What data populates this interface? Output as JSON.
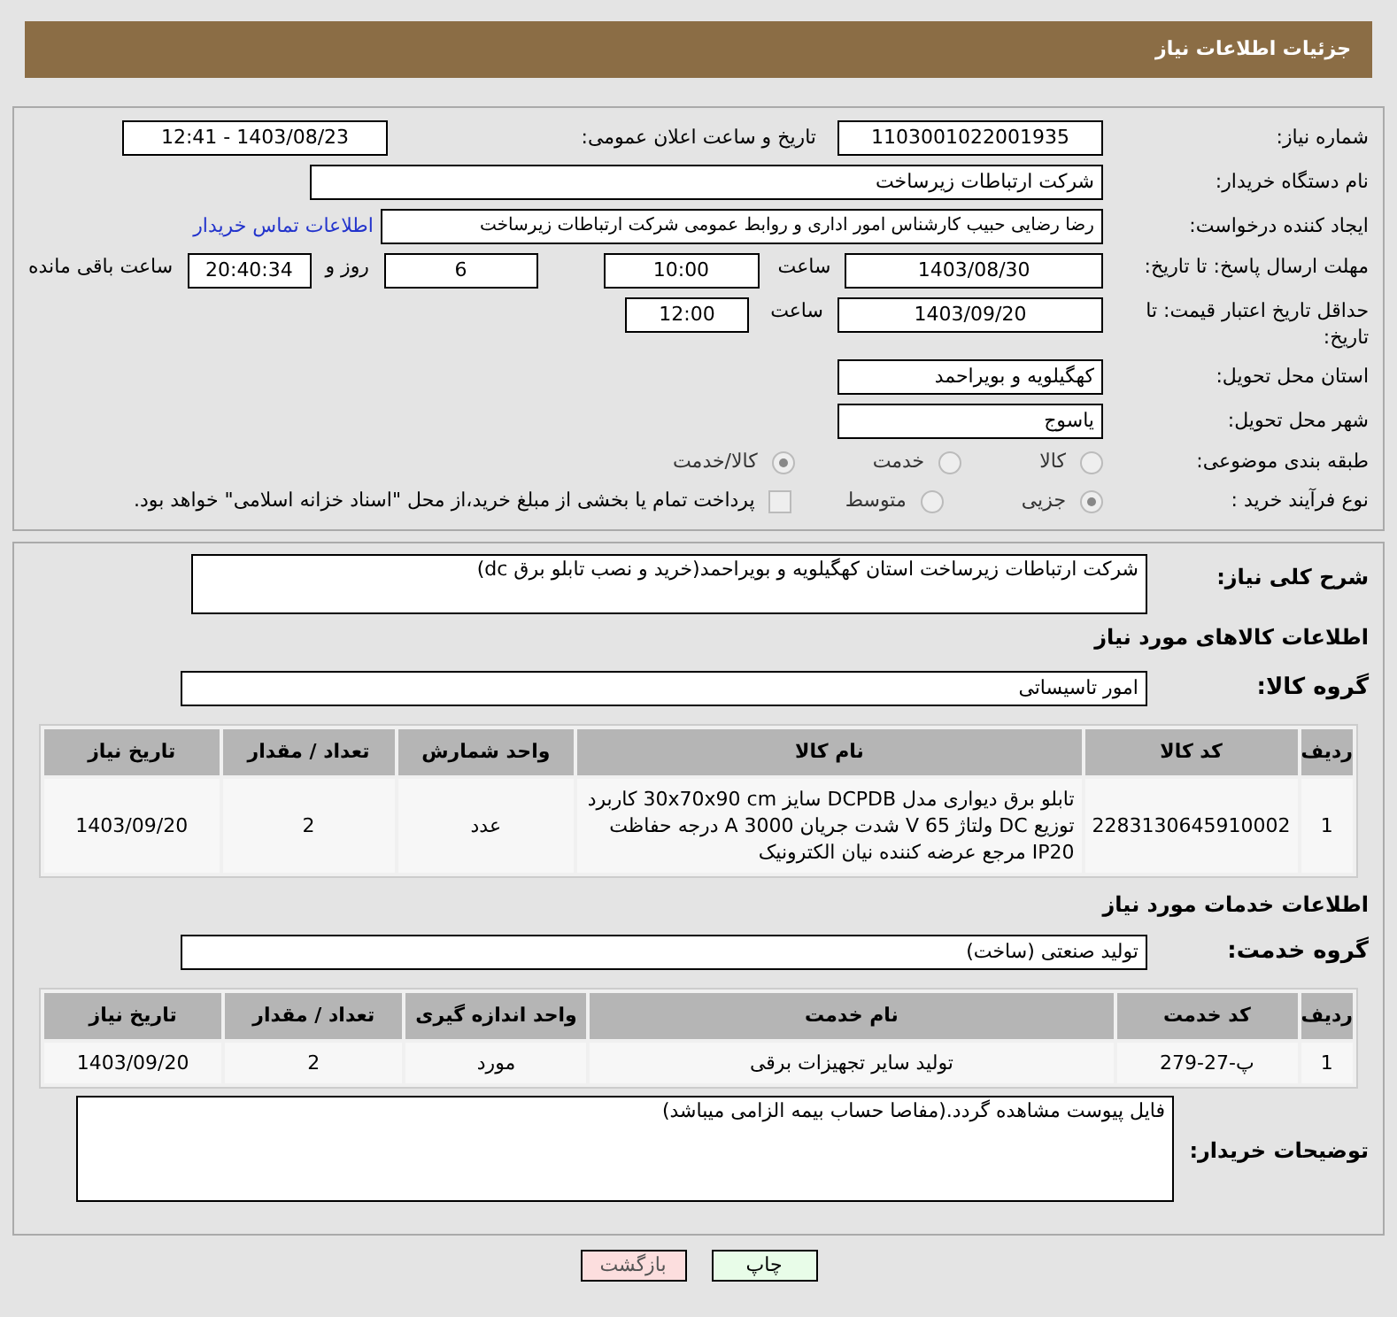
{
  "header": {
    "title": "جزئیات اطلاعات نیاز"
  },
  "need_number": {
    "label": "شماره نیاز:",
    "value": "1103001022001935"
  },
  "announce": {
    "label": "تاریخ و ساعت اعلان عمومی:",
    "value": "1403/08/23 - 12:41"
  },
  "buyer": {
    "label": "نام دستگاه خریدار:",
    "value": "شرکت ارتباطات زیرساخت"
  },
  "requester": {
    "label": "ایجاد کننده درخواست:",
    "value": "رضا رضایی حبیب کارشناس امور اداری و روابط عمومی شرکت ارتباطات زیرساخت",
    "link": "اطلاعات تماس خریدار"
  },
  "reply_deadline": {
    "label": "مهلت ارسال پاسخ: تا تاریخ:",
    "date": "1403/08/30",
    "time_label": "ساعت",
    "time": "10:00",
    "days": "6",
    "days_label": "روز و",
    "remaining": "20:40:34",
    "remaining_label": "ساعت باقی مانده"
  },
  "price_validity": {
    "label": "حداقل تاریخ اعتبار قیمت: تا تاریخ:",
    "date": "1403/09/20",
    "time_label": "ساعت",
    "time": "12:00"
  },
  "province": {
    "label": "استان محل تحویل:",
    "value": "کهگیلویه و بویراحمد"
  },
  "city": {
    "label": "شهر محل تحویل:",
    "value": "یاسوج"
  },
  "category": {
    "label": "طبقه بندی موضوعی:",
    "options": [
      {
        "label": "کالا",
        "selected": false
      },
      {
        "label": "خدمت",
        "selected": false
      },
      {
        "label": "کالا/خدمت",
        "selected": true
      }
    ]
  },
  "purchase_type": {
    "label": "نوع فرآیند خرید :",
    "options": [
      {
        "label": "جزیی",
        "selected": true
      },
      {
        "label": "متوسط",
        "selected": false
      }
    ],
    "payment": {
      "label": "پرداخت تمام یا بخشی از مبلغ خرید،از محل \"اسناد خزانه اسلامی\" خواهد بود.",
      "checked": false
    }
  },
  "description": {
    "label": "شرح کلی نیاز:",
    "value": "شرکت ارتباطات  زیرساخت استان کهگیلویه و بویراحمد(خرید و نصب تابلو برق dc)"
  },
  "goods": {
    "title": "اطلاعات کالاهای مورد نیاز",
    "group_label": "گروه کالا:",
    "group": "امور تاسیساتی",
    "columns": [
      "ردیف",
      "کد کالا",
      "نام کالا",
      "واحد شمارش",
      "تعداد / مقدار",
      "تاریخ نیاز"
    ],
    "rows": [
      [
        "1",
        "2283130645910002",
        "تابلو برق دیواری مدل DCPDB سایز 30x70x90 cm کاربرد توزیع DC ولتاژ 65 V شدت جریان 3000 A درجه حفاظت IP20 مرجع عرضه کننده نیان الکترونیک",
        "عدد",
        "2",
        "1403/09/20"
      ]
    ]
  },
  "services": {
    "title": "اطلاعات خدمات مورد نیاز",
    "group_label": "گروه خدمت:",
    "group": "تولید صنعتی (ساخت)",
    "columns": [
      "ردیف",
      "کد خدمت",
      "نام خدمت",
      "واحد اندازه گیری",
      "تعداد / مقدار",
      "تاریخ نیاز"
    ],
    "rows": [
      [
        "1",
        "پ-27-279",
        "تولید سایر تجهیزات برقی",
        "مورد",
        "2",
        "1403/09/20"
      ]
    ]
  },
  "buyer_notes": {
    "label": "توضیحات خریدار:",
    "value": "فایل پیوست مشاهده گردد.(مفاصا حساب بیمه الزامی میباشد)"
  },
  "buttons": [
    {
      "label": "چاپ",
      "kind": "print"
    },
    {
      "label": "بازگشت",
      "kind": "back"
    }
  ]
}
